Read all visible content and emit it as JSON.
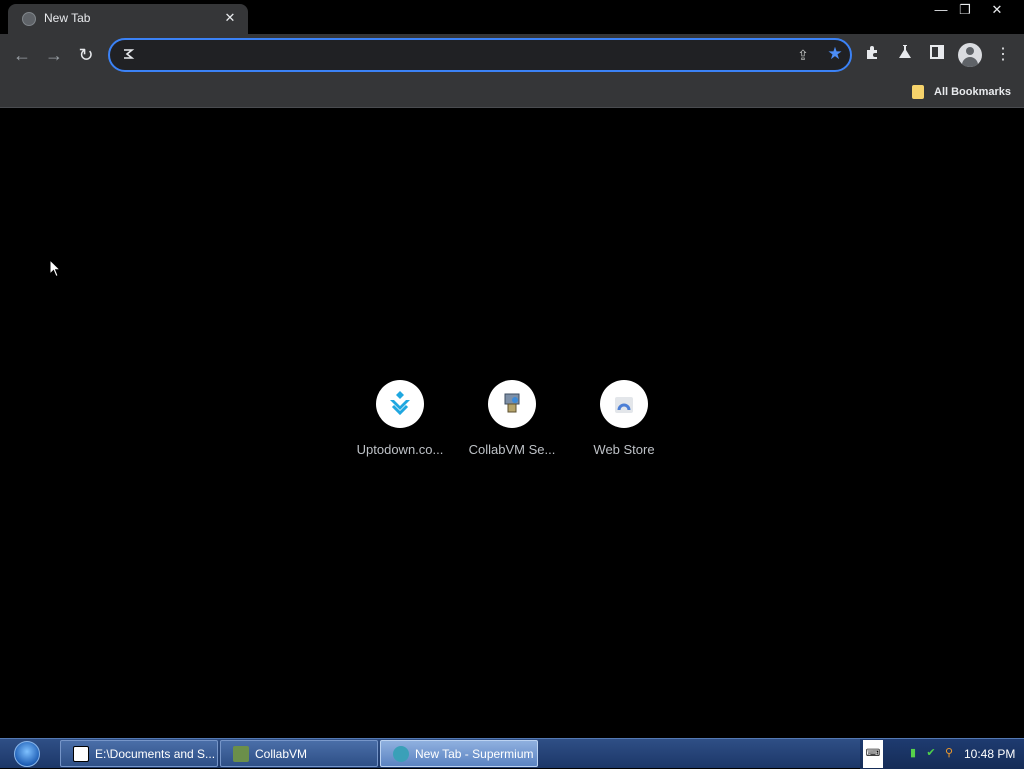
{
  "tab": {
    "title": "New Tab",
    "close_glyph": "✕",
    "favicon": "globe-icon"
  },
  "window_controls": {
    "minimize": "—",
    "restore": "❐",
    "close": "✕"
  },
  "toolbar": {
    "back_glyph": "←",
    "forward_glyph": "→",
    "reload_glyph": "↻",
    "address_value": "",
    "address_placeholder": "",
    "share_glyph": "⇪",
    "star_glyph": "★",
    "extensions_glyph": "✦",
    "labs_glyph": "⚗",
    "sidepanel_glyph": "◨",
    "menu_glyph": "⋮",
    "accent_color": "#3b82f6"
  },
  "bookmarks_bar": {
    "all_bookmarks_label": "All Bookmarks"
  },
  "shortcuts": [
    {
      "label": "Uptodown.co...",
      "icon": "uptodown-icon"
    },
    {
      "label": "CollabVM Se...",
      "icon": "collabvm-icon"
    },
    {
      "label": "Web Store",
      "icon": "web-store-icon"
    }
  ],
  "taskbar": {
    "tasks": [
      {
        "label": "E:\\Documents and S...",
        "icon": "7zip-icon"
      },
      {
        "label": "CollabVM",
        "icon": "cube-icon"
      },
      {
        "label": "New Tab - Supermium",
        "icon": "browser-icon"
      }
    ],
    "tray": {
      "keyboard_label": "⌨",
      "clock": "10:48 PM"
    }
  }
}
